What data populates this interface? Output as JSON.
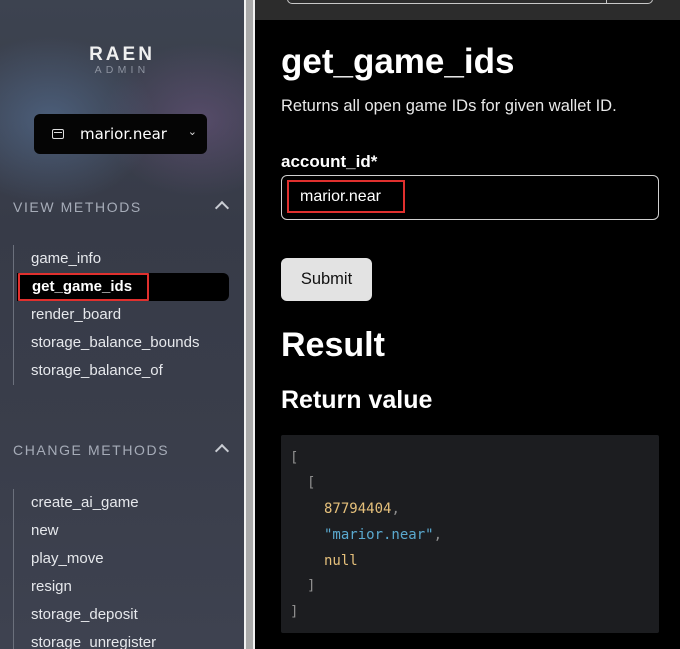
{
  "sidebar": {
    "logo_main": "RAEN",
    "logo_sub": "ADMIN",
    "account": "marior.near",
    "view_methods": {
      "title": "VIEW METHODS",
      "items": [
        "game_info",
        "get_game_ids",
        "render_board",
        "storage_balance_bounds",
        "storage_balance_of"
      ],
      "active": "get_game_ids"
    },
    "change_methods": {
      "title": "CHANGE METHODS",
      "items": [
        "create_ai_game",
        "new",
        "play_move",
        "resign",
        "storage_deposit",
        "storage_unregister"
      ]
    }
  },
  "main": {
    "method_title": "get_game_ids",
    "description": "Returns all open game IDs for given wallet ID.",
    "field_label": "account_id*",
    "field_value": "marior.near",
    "submit_label": "Submit",
    "result_title": "Result",
    "return_title": "Return value",
    "code": {
      "open_outer": "[",
      "open_inner": "[",
      "number": "87794404",
      "string": "\"marior.near\"",
      "null": "null",
      "comma": ",",
      "close_inner": "]",
      "close_outer": "]"
    }
  },
  "colors": {
    "highlight": "#e0302e",
    "code_number": "#e5c07b",
    "code_string": "#5aa9cf"
  }
}
